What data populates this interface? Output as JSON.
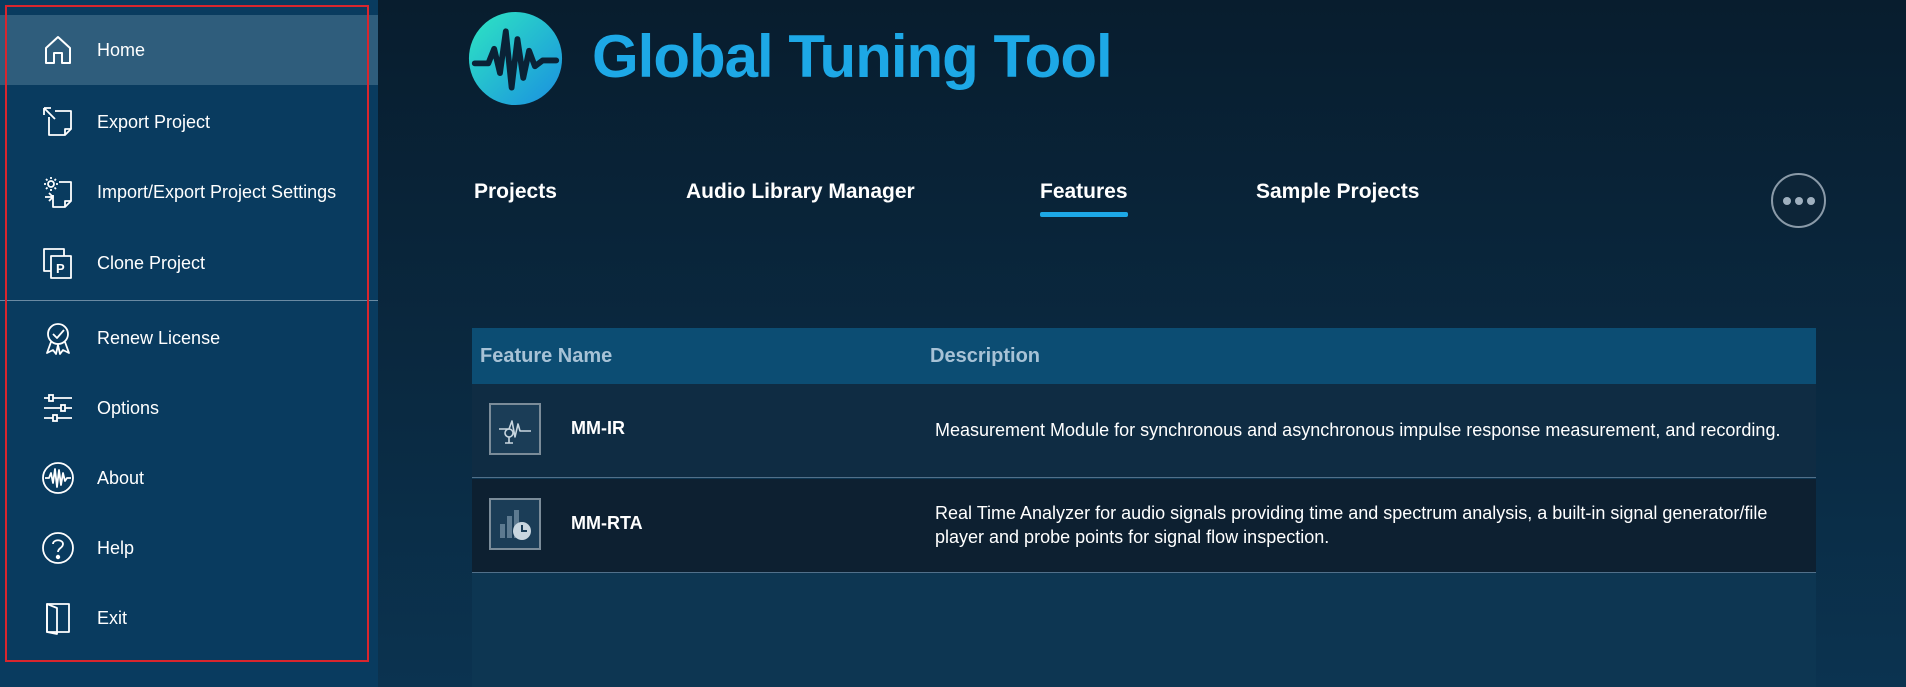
{
  "sidebar": {
    "items": [
      {
        "label": "Home",
        "icon": "home-icon",
        "active": true
      },
      {
        "label": "Export Project",
        "icon": "export-icon"
      },
      {
        "label": "Import/Export Project Settings",
        "icon": "settings-import-icon"
      },
      {
        "label": "Clone Project",
        "icon": "clone-icon"
      },
      {
        "label": "Renew License",
        "icon": "license-badge-icon"
      },
      {
        "label": "Options",
        "icon": "sliders-icon"
      },
      {
        "label": "About",
        "icon": "waveform-icon"
      },
      {
        "label": "Help",
        "icon": "help-icon"
      },
      {
        "label": "Exit",
        "icon": "exit-door-icon"
      }
    ]
  },
  "header": {
    "title": "Global Tuning Tool",
    "logo": "waveform-logo-icon"
  },
  "tabs": [
    {
      "label": "Projects"
    },
    {
      "label": "Audio Library Manager"
    },
    {
      "label": "Features",
      "active": true
    },
    {
      "label": "Sample Projects"
    }
  ],
  "more_button": {
    "icon": "more-dots-icon"
  },
  "table": {
    "columns": [
      "Feature Name",
      "Description"
    ],
    "rows": [
      {
        "name": "MM-IR",
        "icon": "measurement-microphone-icon",
        "description": "Measurement Module for synchronous and asynchronous impulse response measurement, and recording."
      },
      {
        "name": "MM-RTA",
        "icon": "analyzer-chart-clock-icon",
        "description": "Real Time Analyzer for audio signals providing time and spectrum analysis, a built-in signal generator/file player and probe points for signal flow inspection."
      }
    ]
  },
  "colors": {
    "accent": "#1da8e6",
    "sidebar": "#093b5f",
    "highlight_frame": "#d8262e"
  }
}
